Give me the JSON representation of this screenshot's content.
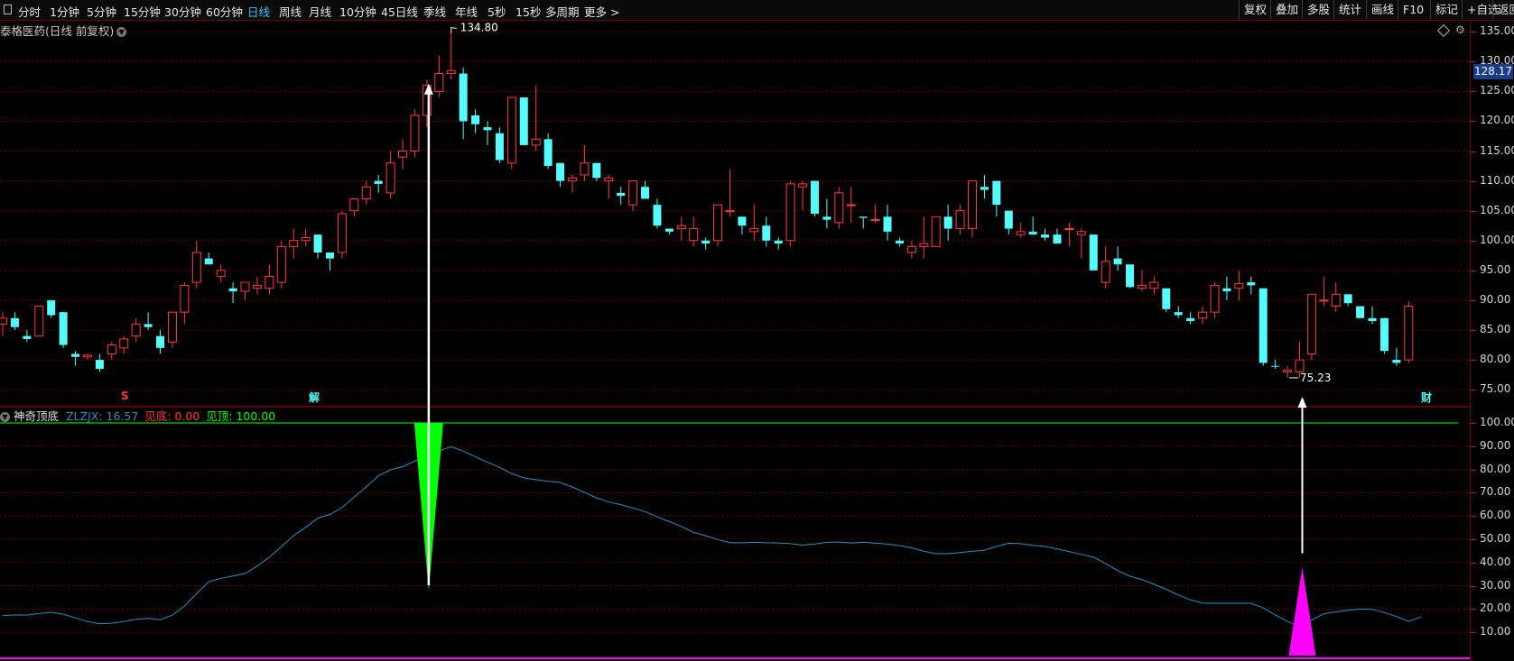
{
  "toolbar": {
    "periods": [
      {
        "label": "分时",
        "active": false
      },
      {
        "label": "1分钟",
        "active": false
      },
      {
        "label": "5分钟",
        "active": false
      },
      {
        "label": "15分钟",
        "active": false
      },
      {
        "label": "30分钟",
        "active": false
      },
      {
        "label": "60分钟",
        "active": false
      },
      {
        "label": "日线",
        "active": true
      },
      {
        "label": "周线",
        "active": false
      },
      {
        "label": "月线",
        "active": false
      },
      {
        "label": "10分钟",
        "active": false
      },
      {
        "label": "45日线",
        "active": false
      },
      {
        "label": "季线",
        "active": false
      },
      {
        "label": "年线",
        "active": false
      },
      {
        "label": "5秒",
        "active": false
      },
      {
        "label": "15秒",
        "active": false
      },
      {
        "label": "多周期",
        "active": false
      },
      {
        "label": "更多 >",
        "active": false
      }
    ],
    "right": [
      "复权",
      "叠加",
      "多股",
      "统计",
      "画线",
      "F10",
      "标记",
      "+自选",
      "返回"
    ]
  },
  "header": {
    "title": "泰格医药(日线 前复权)"
  },
  "indicator": {
    "name": "神奇顶底",
    "zlzjx": "ZLZJX: 16.57",
    "bottom": "见底: 0.00",
    "top": "见顶: 100.00"
  },
  "price_axis": {
    "current_price": "128.17",
    "labels": [
      "135.00",
      "130.00",
      "125.00",
      "120.00",
      "115.00",
      "110.00",
      "105.00",
      "100.00",
      "95.00",
      "90.00",
      "85.00",
      "80.00",
      "75.00"
    ]
  },
  "ind_axis": {
    "labels": [
      "100.00",
      "90.00",
      "80.00",
      "70.00",
      "60.00",
      "50.00",
      "40.00",
      "30.00",
      "20.00",
      "10.00"
    ]
  },
  "annotations": {
    "high": "134.80",
    "low": "75.23",
    "marker_s": "S",
    "marker_jie": "解",
    "marker_cai": "财"
  },
  "colors": {
    "up": "#ff3c3c",
    "down": "#54fcfc",
    "green": "#00ff00",
    "magenta": "#ff00ff",
    "line": "#2f8fb6",
    "grid": "#6a0000"
  },
  "chart_data": [
    {
      "type": "candlestick",
      "title": "泰格医药(日线 前复权)",
      "ylim": [
        72,
        137
      ],
      "ohlc": [
        [
          86,
          88,
          84,
          87
        ],
        [
          87,
          88,
          85,
          85.5
        ],
        [
          84,
          85,
          83,
          83.5
        ],
        [
          84,
          89,
          84,
          89
        ],
        [
          90,
          90,
          87,
          87.5
        ],
        [
          88,
          88,
          82,
          82.5
        ],
        [
          81,
          81.5,
          79,
          80.5
        ],
        [
          80.5,
          81,
          80,
          80.8
        ],
        [
          80,
          81,
          78,
          78.5
        ],
        [
          81,
          83,
          80,
          82.5
        ],
        [
          82,
          84,
          81,
          83.5
        ],
        [
          84,
          87,
          83,
          86
        ],
        [
          86,
          88,
          85,
          85.5
        ],
        [
          84,
          85,
          81,
          82
        ],
        [
          83,
          88,
          82,
          88
        ],
        [
          88,
          93,
          86,
          92.5
        ],
        [
          93,
          100,
          92,
          98
        ],
        [
          97,
          98,
          96,
          96
        ],
        [
          94,
          96,
          93,
          95
        ],
        [
          92,
          93,
          89.5,
          91.5
        ],
        [
          91.5,
          93,
          90,
          93
        ],
        [
          92,
          94,
          91,
          92.5
        ],
        [
          92,
          96,
          91,
          94
        ],
        [
          93,
          100,
          92,
          99
        ],
        [
          99,
          102,
          97,
          100
        ],
        [
          100,
          102,
          99,
          100.5
        ],
        [
          101,
          101,
          97,
          98
        ],
        [
          98,
          98,
          95,
          97
        ],
        [
          98,
          105,
          97,
          104.5
        ],
        [
          105,
          107,
          104,
          107
        ],
        [
          107,
          110,
          106,
          109
        ],
        [
          110,
          111,
          108,
          109.5
        ],
        [
          108,
          115,
          107,
          113
        ],
        [
          114,
          117,
          112,
          115
        ],
        [
          115,
          122,
          114,
          121
        ],
        [
          121,
          127,
          119,
          126
        ],
        [
          125,
          131,
          124,
          128
        ],
        [
          128,
          134.8,
          127,
          128.5
        ],
        [
          128,
          129,
          117,
          120
        ],
        [
          121,
          122,
          118,
          119.5
        ],
        [
          119,
          120,
          116,
          118.5
        ],
        [
          118,
          119,
          113,
          113.5
        ],
        [
          113,
          124,
          112,
          124
        ],
        [
          124,
          124,
          116,
          116
        ],
        [
          116,
          126,
          115,
          117
        ],
        [
          117,
          118,
          112,
          112.5
        ],
        [
          113,
          113,
          109,
          110
        ],
        [
          110,
          111,
          108,
          110.5
        ],
        [
          111,
          116,
          110,
          113
        ],
        [
          113,
          113,
          110,
          110.5
        ],
        [
          110,
          111,
          107,
          110.5
        ],
        [
          108,
          109,
          106,
          107.5
        ],
        [
          106,
          110,
          105,
          110
        ],
        [
          109,
          110,
          107,
          107
        ],
        [
          106,
          107,
          102,
          102.5
        ],
        [
          102,
          102,
          101,
          101.5
        ],
        [
          102,
          104,
          100,
          102.5
        ],
        [
          100,
          104,
          99,
          102
        ],
        [
          100,
          100.5,
          98.5,
          99.5
        ],
        [
          100,
          106,
          99,
          106
        ],
        [
          105,
          112,
          104,
          105
        ],
        [
          104,
          104,
          101,
          102.5
        ],
        [
          101.5,
          106,
          100,
          102
        ],
        [
          102.5,
          104,
          99,
          100
        ],
        [
          100,
          100.5,
          98.5,
          99.5
        ],
        [
          100,
          110,
          99,
          109.5
        ],
        [
          109,
          110,
          105,
          109.5
        ],
        [
          110,
          110,
          104,
          104.5
        ],
        [
          104,
          107,
          102,
          103.5
        ],
        [
          103,
          109,
          102,
          108
        ],
        [
          106,
          109,
          103,
          106
        ],
        [
          104,
          104,
          102,
          103.8
        ],
        [
          103.5,
          106,
          103,
          103.5
        ],
        [
          104,
          106,
          100,
          101.5
        ],
        [
          100,
          100.5,
          99,
          99.5
        ],
        [
          98,
          100,
          97,
          99
        ],
        [
          99,
          104,
          97,
          99.5
        ],
        [
          99,
          104,
          99,
          104
        ],
        [
          104,
          106,
          100,
          102
        ],
        [
          102,
          106,
          101,
          105
        ],
        [
          102,
          110,
          100.5,
          110
        ],
        [
          109,
          111,
          107,
          108.5
        ],
        [
          110,
          110,
          104,
          106
        ],
        [
          105,
          105,
          101,
          102
        ],
        [
          101,
          103,
          100.5,
          101.5
        ],
        [
          101.5,
          104,
          101,
          101
        ],
        [
          101,
          102,
          100,
          100.5
        ],
        [
          101,
          102,
          99.5,
          99.5
        ],
        [
          102,
          103,
          99,
          102
        ],
        [
          101,
          102,
          97,
          101.5
        ],
        [
          101,
          101,
          95,
          95
        ],
        [
          93,
          99,
          92,
          96.5
        ],
        [
          97,
          99,
          95,
          96
        ],
        [
          96,
          96,
          92,
          92.2
        ],
        [
          92,
          95,
          91.5,
          92.5
        ],
        [
          92,
          94,
          91,
          93
        ],
        [
          92,
          92,
          88,
          88.5
        ],
        [
          88,
          89,
          87,
          87.5
        ],
        [
          87,
          88,
          86,
          86.5
        ],
        [
          87,
          89,
          86,
          88
        ],
        [
          88,
          93,
          87,
          92.5
        ],
        [
          92,
          94,
          90,
          91.5
        ],
        [
          92,
          95,
          90,
          92.8
        ],
        [
          93,
          94,
          91,
          92.5
        ],
        [
          92,
          92,
          79,
          79.5
        ],
        [
          79,
          80,
          78.5,
          78.9
        ],
        [
          78,
          79,
          77,
          78.3
        ],
        [
          78,
          83,
          77,
          80
        ],
        [
          81,
          91,
          80,
          91
        ],
        [
          90,
          94,
          89,
          90
        ],
        [
          89,
          93,
          88,
          91
        ],
        [
          91,
          91,
          89,
          89.5
        ],
        [
          89,
          89,
          87,
          87
        ],
        [
          87,
          89,
          86,
          86.5
        ],
        [
          87,
          87,
          81,
          81.5
        ],
        [
          80,
          82,
          79,
          79.5
        ],
        [
          80,
          89.8,
          79.5,
          89
        ]
      ]
    },
    {
      "type": "line",
      "title": "神奇顶底",
      "ylim": [
        0,
        100
      ],
      "series": [
        {
          "name": "ZLZJX",
          "values": [
            17.2,
            17.5,
            17.4,
            18.1,
            18.6,
            17.8,
            16.2,
            14.6,
            13.7,
            13.9,
            14.7,
            15.6,
            16,
            15.4,
            17.4,
            21.3,
            26.7,
            31.7,
            33.2,
            34.2,
            35.3,
            38.5,
            42.3,
            46.8,
            51.6,
            55.1,
            59.1,
            60.7,
            63.6,
            68.1,
            72.6,
            77.3,
            79.9,
            81.2,
            83.6,
            86.1,
            87.9,
            89.8,
            87.9,
            85.4,
            83.1,
            80.9,
            78.2,
            76.4,
            75.6,
            74.9,
            74.4,
            72.5,
            70.1,
            67.8,
            66,
            64.9,
            63.4,
            61.9,
            59.6,
            57.6,
            55.5,
            53,
            51.5,
            49.9,
            48.5,
            48.5,
            48.7,
            48.5,
            48.4,
            48.1,
            47.5,
            48,
            48.7,
            48.8,
            48.4,
            48.7,
            48.3,
            47.9,
            47.3,
            46.3,
            44.9,
            43.8,
            43.8,
            44.3,
            44.9,
            45.3,
            46.9,
            48.3,
            48.1,
            47.4,
            46.9,
            45.9,
            44.7,
            43.5,
            42.3,
            39.5,
            36.5,
            34.1,
            32.7,
            30.6,
            28.5,
            26.1,
            23.9,
            22.6,
            22.5,
            22.5,
            22.5,
            22.5,
            20.5,
            17.5,
            14.6,
            12.5,
            15.3,
            18,
            18.8,
            19.5,
            20,
            19.9,
            18.5,
            16.8,
            14.7,
            16.6
          ]
        }
      ],
      "signals": {
        "top_at_index": 35,
        "bottom_at_index": 107
      }
    }
  ]
}
